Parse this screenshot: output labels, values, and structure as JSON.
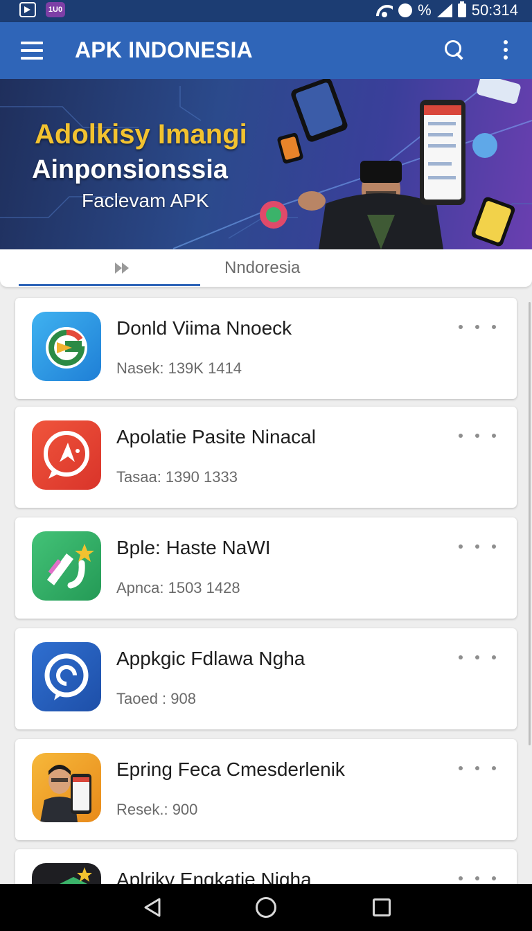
{
  "status_bar": {
    "app2_label": "1U0",
    "battery_text": "%",
    "time": "50:314"
  },
  "app_bar": {
    "title": "APK INDONESIA",
    "icons": [
      "menu-icon",
      "search-icon",
      "more-vert-icon"
    ]
  },
  "banner": {
    "line1": "Adolkisy Imangi",
    "line2": "Ainponsionssia",
    "line3": "Faclevam APK"
  },
  "tabs": {
    "first_tab_icon": "fast-forward-icon",
    "second_tab_label": "Nndoresia",
    "selected": 0
  },
  "apps": [
    {
      "title": "Donld Viima Nnoeck",
      "meta": "Nasek: 139K  1414",
      "icon": "g-arrow-icon"
    },
    {
      "title": "Apolatie Pasite Ninacal",
      "meta": "Tasaa: 1390  1333",
      "icon": "chat-arrow-icon"
    },
    {
      "title": "Bple: Haste NaWI",
      "meta": "Apnca: 1503  1428",
      "icon": "pen-star-icon"
    },
    {
      "title": "Appkgic Fdlawa Ngha",
      "meta": "Taoed : 908",
      "icon": "chat-spiral-icon"
    },
    {
      "title": "Epring Feca Cmesderlenik",
      "meta": "Resek.: 900",
      "icon": "person-phone-icon"
    },
    {
      "title": "Aplriky Enqkatie Nigha",
      "meta": "",
      "icon": "colorful-app-icon"
    }
  ],
  "colors": {
    "status_bar": "#1c3d73",
    "app_bar": "#2f65b8",
    "banner_title": "#f2c230"
  },
  "nav_bar": {
    "icons": [
      "back-icon",
      "home-icon",
      "recents-icon"
    ]
  }
}
